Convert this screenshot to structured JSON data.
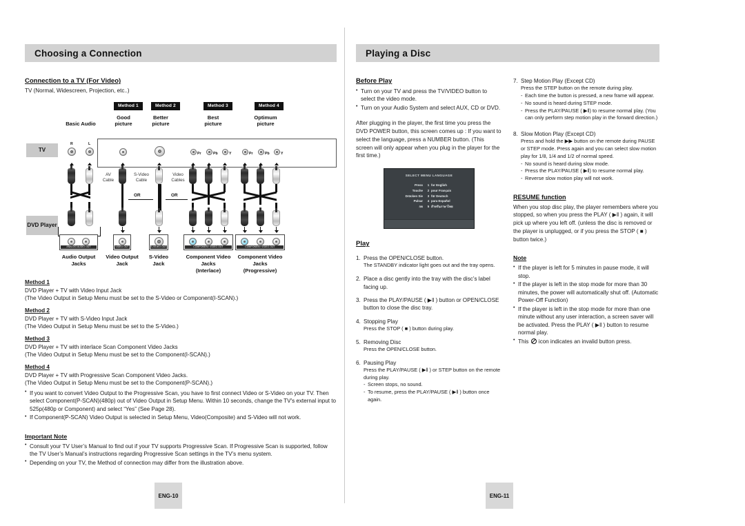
{
  "left_page": {
    "header_title": "Choosing a Connection",
    "sub_head": "Connection to a TV (For Video)",
    "tv_line": "TV (Normal, Widescreen, Projection, etc..)",
    "diagram": {
      "method_tags": [
        "Method 1",
        "Method 2",
        "Method 3",
        "Method 4"
      ],
      "quality_labels": [
        {
          "l1": "Basic Audio",
          "l2": ""
        },
        {
          "l1": "Good",
          "l2": "picture"
        },
        {
          "l1": "Better",
          "l2": "picture"
        },
        {
          "l1": "Best",
          "l2": "picture"
        },
        {
          "l1": "Optimum",
          "l2": "picture"
        }
      ],
      "side_chips": [
        "TV",
        "DVD Player"
      ],
      "tv_jack_labels": [
        "R",
        "L",
        "Pr",
        "Pb",
        "Y",
        "Pr",
        "Pb",
        "Y"
      ],
      "cable_notes": [
        {
          "l1": "AV",
          "l2": "Cable"
        },
        {
          "l1": "S-Video",
          "l2": "Cable"
        },
        {
          "l1": "Video",
          "l2": "Cables"
        }
      ],
      "or_labels": [
        "OR",
        "OR"
      ],
      "panel_captions": [
        "ANALOG AUDIO OUT",
        "VIDEO OUT",
        "S-VIDEO OUT",
        "COMPONENT VIDEO OUT",
        "COMPONENT VIDEO OUT"
      ],
      "jack_captions": [
        {
          "l1": "Audio Output",
          "l2": "Jacks",
          "l3": ""
        },
        {
          "l1": "Video Output",
          "l2": "Jack",
          "l3": ""
        },
        {
          "l1": "S-Video",
          "l2": "Jack",
          "l3": ""
        },
        {
          "l1": "Component Video",
          "l2": "Jacks",
          "l3": "(Interlace)"
        },
        {
          "l1": "Component Video",
          "l2": "Jacks",
          "l3": "(Progressive)"
        }
      ]
    },
    "methods": [
      {
        "title": "Method 1",
        "line1": "DVD Player + TV with Video Input Jack",
        "line2": "(The Video Output in Setup Menu must be set to the S-Video or Component(I-SCAN).)"
      },
      {
        "title": "Method 2",
        "line1": "DVD Player + TV with S-Video Input Jack",
        "line2": "(The Video Output in Setup Menu must be set to the S-Video.)"
      },
      {
        "title": "Method 3",
        "line1": "DVD Player + TV with interlace Scan Component Video Jacks",
        "line2": "(The Video Output in Setup Menu must be set to the Component(I-SCAN).)"
      },
      {
        "title": "Method 4",
        "line1": "DVD Player + TV with Progressive Scan Component Video Jacks.",
        "line2": "(The Video Output in Setup Menu must be set to the Component(P-SCAN).)"
      }
    ],
    "method_bullets": [
      "If you want to convert Video Output to the Progressive Scan, you have to first connect Video or S-Video on your TV. Then select Component(P-SCAN)(480p) out of Video Output in Setup Menu. Within 10 seconds, change the TV's external input to 525p(480p or Component) and select “Yes” (See Page 28).",
      "If Component(P-SCAN) Video Output is selected in Setup Menu, Video(Composite) and S-Video will not work."
    ],
    "important_note_title": "Important Note",
    "important_note_bullets": [
      "Consult your TV User’s Manual to find out if your TV supports Progressive Scan. If Progressive Scan is supported, follow the TV User’s Manual’s instructions regarding Progressive Scan settings in the TV’s menu system.",
      "Depending on your TV, the Method of connection may differ from the illustration above."
    ],
    "footer": "ENG-10"
  },
  "right_page": {
    "header_title": "Playing a Disc",
    "before_play": {
      "title": "Before Play",
      "bullets": [
        "Turn on your TV and press the TV/VIDEO button to select the video mode.",
        "Turn on your Audio System and select AUX, CD or DVD."
      ],
      "paragraph": "After plugging in the player, the first time you press the DVD POWER button, this screen comes up : If you want to select the language, press a NUMBER button. (This screen will only appear when you plug in the player for the first time.)"
    },
    "tv_screen": {
      "title": "SELECT MENU LANGUAGE",
      "rows": [
        {
          "verb": "Press",
          "num": "1",
          "lang": "for English"
        },
        {
          "verb": "Touche",
          "num": "2",
          "lang": "pour Français"
        },
        {
          "verb": "Drücken Sie",
          "num": "3",
          "lang": "für Deutsch"
        },
        {
          "verb": "Pulsar",
          "num": "4",
          "lang": "para Español"
        },
        {
          "verb": "กด",
          "num": "5",
          "lang": "สำหรับภาษาไทย"
        }
      ]
    },
    "play": {
      "title": "Play",
      "steps": [
        {
          "num": "1.",
          "head": "Press the OPEN/CLOSE button.",
          "sub": "The STANDBY indicator light goes out and the tray opens.",
          "dashes": []
        },
        {
          "num": "2.",
          "head": "Place a disc gently into the tray with the disc’s label facing up.",
          "sub": "",
          "dashes": []
        },
        {
          "num": "3.",
          "head": "Press the PLAY/PAUSE (  ▶‖ ) button or OPEN/CLOSE button to close the disc tray.",
          "sub": "",
          "dashes": []
        },
        {
          "num": "4.",
          "head": "Stopping Play",
          "sub": "Press the STOP (  ■  ) button during play.",
          "dashes": []
        },
        {
          "num": "5.",
          "head": "Removing Disc",
          "sub": "Press the OPEN/CLOSE button.",
          "dashes": []
        },
        {
          "num": "6.",
          "head": "Pausing Play",
          "sub": "Press the PLAY/PAUSE (  ▶‖ ) or STEP button on the remote during play.",
          "dashes": [
            "Screen stops, no sound.",
            "To resume, press the PLAY/PAUSE (  ▶‖ ) button once again."
          ]
        }
      ]
    },
    "steps_right": [
      {
        "num": "7.",
        "head": "Step Motion Play (Except CD)",
        "sub": "Press the STEP button on the remote during play.",
        "dashes": [
          "Each time the button is pressed, a new frame will appear.",
          "No sound is heard during STEP mode.",
          "Press the PLAY/PAUSE ( ▶‖) to resume normal play. (You can only perform step motion play in the forward direction.)"
        ]
      },
      {
        "num": "8.",
        "head": "Slow Motion Play (Except CD)",
        "sub": "Press and hold the  ▶▶  button on the remote during PAUSE or STEP mode. Press again and you can select slow motion play for 1/8, 1/4 and 1/2 of normal speed.",
        "dashes": [
          "No sound is heard during slow mode.",
          "Press the PLAY/PAUSE ( ▶‖) to resume normal play.",
          "Reverse slow motion play will not work."
        ]
      }
    ],
    "resume": {
      "title": "RESUME function",
      "paragraph": "When you stop disc play, the player remembers where you stopped, so when you press the PLAY ( ▶‖ ) again, it will pick up where you left off. (unless the disc is removed or the player is unplugged, or if you press the STOP ( ■ ) button twice.)"
    },
    "note": {
      "title": "Note",
      "bullets": [
        "If the player is left for 5 minutes in pause mode, it will stop.",
        "If the player is left in the stop mode for more than 30 minutes, the power will automatically shut off. (Automatic Power-Off Function)",
        "If the player is left in the stop mode for more than one minute without any user interaction, a screen saver will be activated. Press the PLAY ( ▶‖ ) button to resume normal play."
      ],
      "last_bullet_pre": "This",
      "last_bullet_post": "icon indicates an invalid button press."
    },
    "footer": "ENG-11"
  },
  "colors": {
    "header_bar": "#d2d2d2",
    "method_tag_bg": "#111111",
    "footer_bg": "#d8d8d8",
    "screen_bg": "#3b4044"
  }
}
